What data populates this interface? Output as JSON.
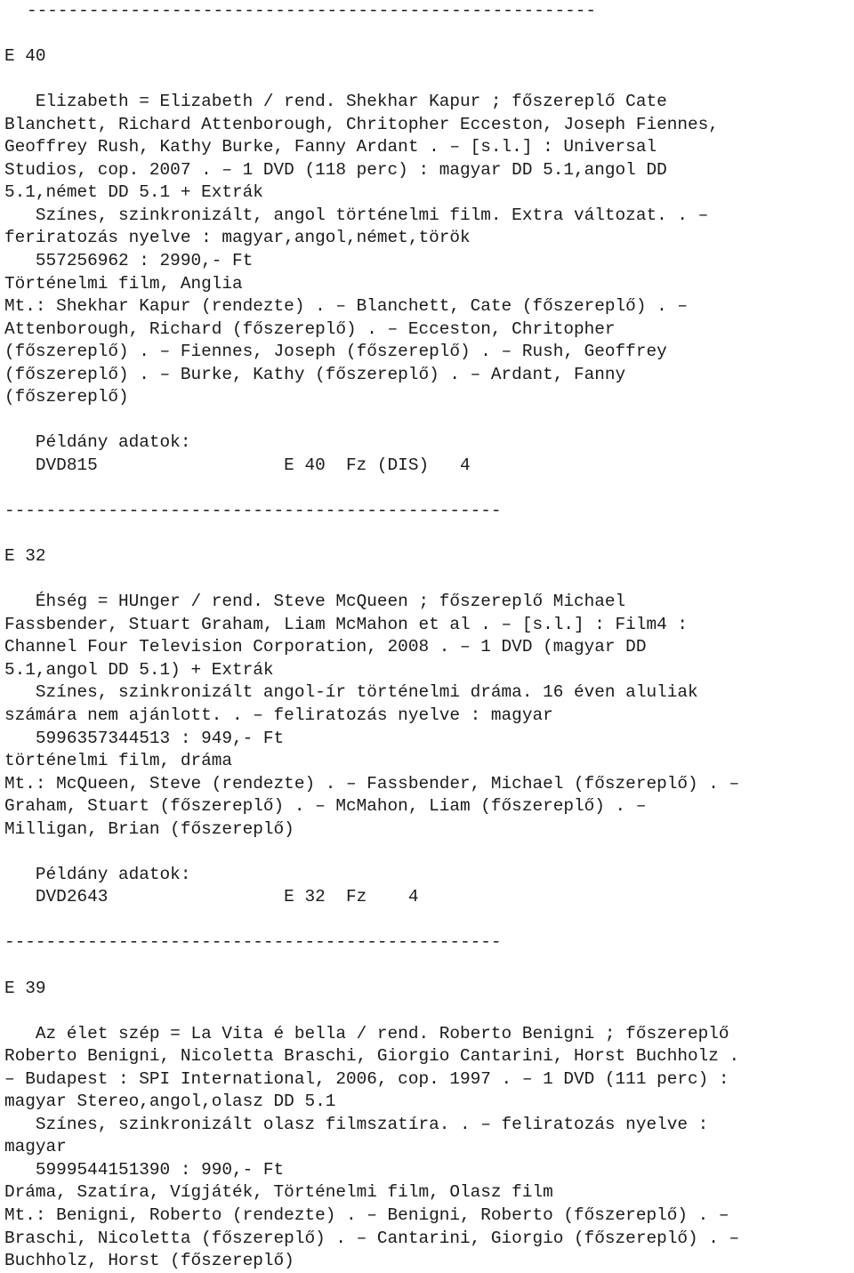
{
  "page": {
    "kind": "library-catalog-printout",
    "language": "hu",
    "background_color": "#ffffff",
    "text_color": "#1a1a1a"
  },
  "rules": {
    "top": "-------------------------------------------------------",
    "inner": "------------------------------------------------"
  },
  "labels": {
    "copies_header": "   Példány adatok:"
  },
  "records": [
    {
      "id": "E 40",
      "description": "   Elizabeth = Elizabeth / rend. Shekhar Kapur ; főszereplő Cate\nBlanchett, Richard Attenborough, Chritopher Ecceston, Joseph Fiennes,\nGeoffrey Rush, Kathy Burke, Fanny Ardant . – [s.l.] : Universal\nStudios, cop. 2007 . – 1 DVD (118 perc) : magyar DD 5.1,angol DD\n5.1,német DD 5.1 + Extrák\n   Színes, szinkronizált, angol történelmi film. Extra változat. . –\nferiratozás nyelve : magyar,angol,német,török\n   557256962 : 2990,- Ft\nTörténelmi film, Anglia\nMt.: Shekhar Kapur (rendezte) . – Blanchett, Cate (főszereplő) . –\nAttenborough, Richard (főszereplő) . – Ecceston, Chritopher\n(főszereplő) . – Fiennes, Joseph (főszereplő) . – Rush, Geoffrey\n(főszereplő) . – Burke, Kathy (főszereplő) . – Ardant, Fanny\n(főszereplő)",
      "copy": "   DVD815                  E 40  Fz (DIS)   4"
    },
    {
      "id": "E 32",
      "description": "   Éhség = HUnger / rend. Steve McQueen ; főszereplő Michael\nFassbender, Stuart Graham, Liam McMahon et al . – [s.l.] : Film4 :\nChannel Four Television Corporation, 2008 . – 1 DVD (magyar DD\n5.1,angol DD 5.1) + Extrák\n   Színes, szinkronizált angol-ír történelmi dráma. 16 éven aluliak\nszámára nem ajánlott. . – feliratozás nyelve : magyar\n   5996357344513 : 949,- Ft\ntörténelmi film, dráma\nMt.: McQueen, Steve (rendezte) . – Fassbender, Michael (főszereplő) . –\nGraham, Stuart (főszereplő) . – McMahon, Liam (főszereplő) . –\nMilligan, Brian (főszereplő)",
      "copy": "   DVD2643                 E 32  Fz    4"
    },
    {
      "id": "E 39",
      "description": "   Az élet szép = La Vita é bella / rend. Roberto Benigni ; főszereplő\nRoberto Benigni, Nicoletta Braschi, Giorgio Cantarini, Horst Buchholz .\n– Budapest : SPI International, 2006, cop. 1997 . – 1 DVD (111 perc) :\nmagyar Stereo,angol,olasz DD 5.1\n   Színes, szinkronizált olasz filmszatíra. . – feliratozás nyelve :\nmagyar\n   5999544151390 : 990,- Ft\nDráma, Szatíra, Vígjáték, Történelmi film, Olasz film\nMt.: Benigni, Roberto (rendezte) . – Benigni, Roberto (főszereplő) . –\nBraschi, Nicoletta (főszereplő) . – Cantarini, Giorgio (főszereplő) . –\nBuchholz, Horst (főszereplő)",
      "copy": null
    }
  ]
}
